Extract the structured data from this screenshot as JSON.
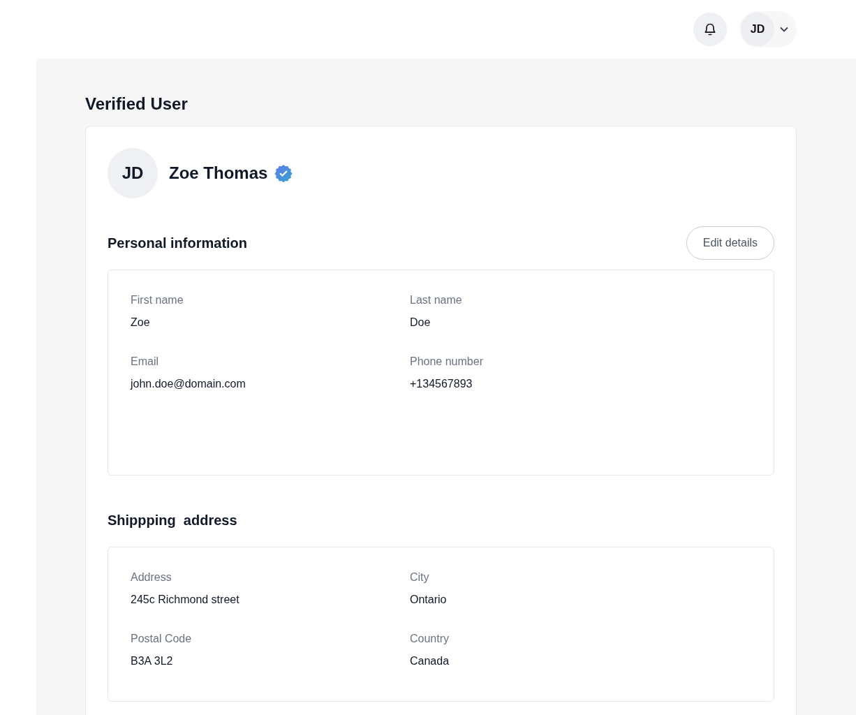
{
  "top_bar": {
    "user_initials": "JD"
  },
  "page_title": "Verified User",
  "profile": {
    "initials": "JD",
    "name": "Zoe Thomas",
    "verified": true
  },
  "sections": [
    {
      "title": "Personal information",
      "button": "Edit details",
      "fields": [
        {
          "label": "First name",
          "value": "Zoe"
        },
        {
          "label": "Last name",
          "value": "Doe"
        },
        {
          "label": "Email",
          "value": "john.doe@domain.com"
        },
        {
          "label": "Phone number",
          "value": "+134567893"
        }
      ]
    },
    {
      "title": "Shippping  address",
      "fields": [
        {
          "label": "Address",
          "value": "245c Richmond street"
        },
        {
          "label": "City",
          "value": "Ontario"
        },
        {
          "label": "Postal Code",
          "value": "B3A 3L2"
        },
        {
          "label": "Country",
          "value": "Canada"
        }
      ]
    }
  ]
}
